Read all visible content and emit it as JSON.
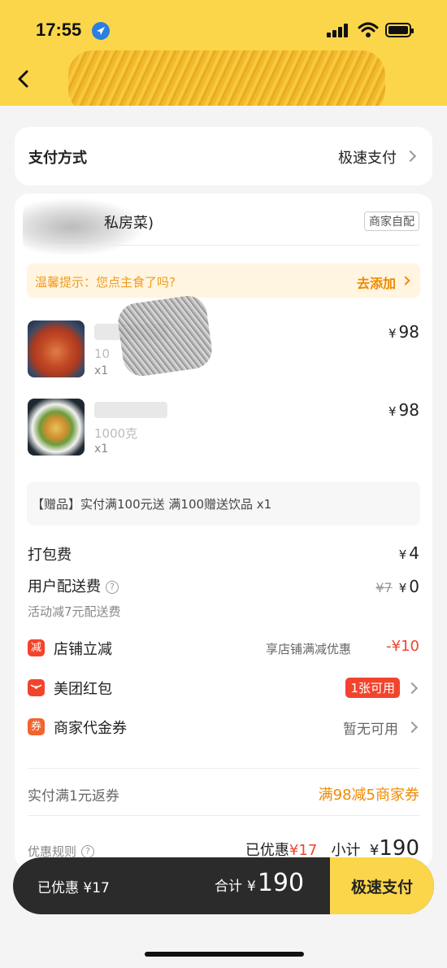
{
  "status_bar": {
    "time": "17:55"
  },
  "payment": {
    "label": "支付方式",
    "value": "极速支付"
  },
  "shop": {
    "name": "私房菜)",
    "delivery_tag": "商家自配"
  },
  "tip": {
    "text": "温馨提示：您点主食了吗?",
    "action": "去添加"
  },
  "items": [
    {
      "subtitle": "10",
      "qty": "x1",
      "currency": "¥",
      "price": "98"
    },
    {
      "subtitle": "1000克",
      "qty": "x1",
      "currency": "¥",
      "price": "98"
    }
  ],
  "gift": {
    "text": "【赠品】实付满100元送 满100赠送饮品 x1"
  },
  "fees": {
    "packing_label": "打包费",
    "packing_currency": "¥",
    "packing_value": "4",
    "delivery_label": "用户配送费",
    "delivery_original": "¥7",
    "delivery_currency": "¥",
    "delivery_value": "0",
    "delivery_note": "活动减7元配送费"
  },
  "discounts": {
    "store": {
      "badge": "减",
      "label": "店铺立减",
      "note": "享店铺满减优惠",
      "amount": "-¥10"
    },
    "redpacket": {
      "label": "美团红包",
      "pill": "1张可用"
    },
    "voucher": {
      "badge": "券",
      "label": "商家代金券",
      "status": "暂无可用"
    }
  },
  "rebate": {
    "label": "实付满1元返券",
    "value": "满98减5商家券"
  },
  "summary": {
    "rules_label": "优惠规则",
    "saved_label": "已优惠",
    "saved_value": "¥17",
    "subtotal_label": "小计",
    "subtotal_currency": "¥",
    "subtotal_value": "190"
  },
  "bottom_bar": {
    "saved_text": "已优惠 ¥17",
    "total_label": "合计",
    "total_currency": "¥",
    "total_value": "190",
    "pay_button": "极速支付"
  },
  "colors": {
    "brand_yellow": "#fcd64a",
    "discount_red": "#f2442d",
    "accent_orange": "#f08a00"
  }
}
